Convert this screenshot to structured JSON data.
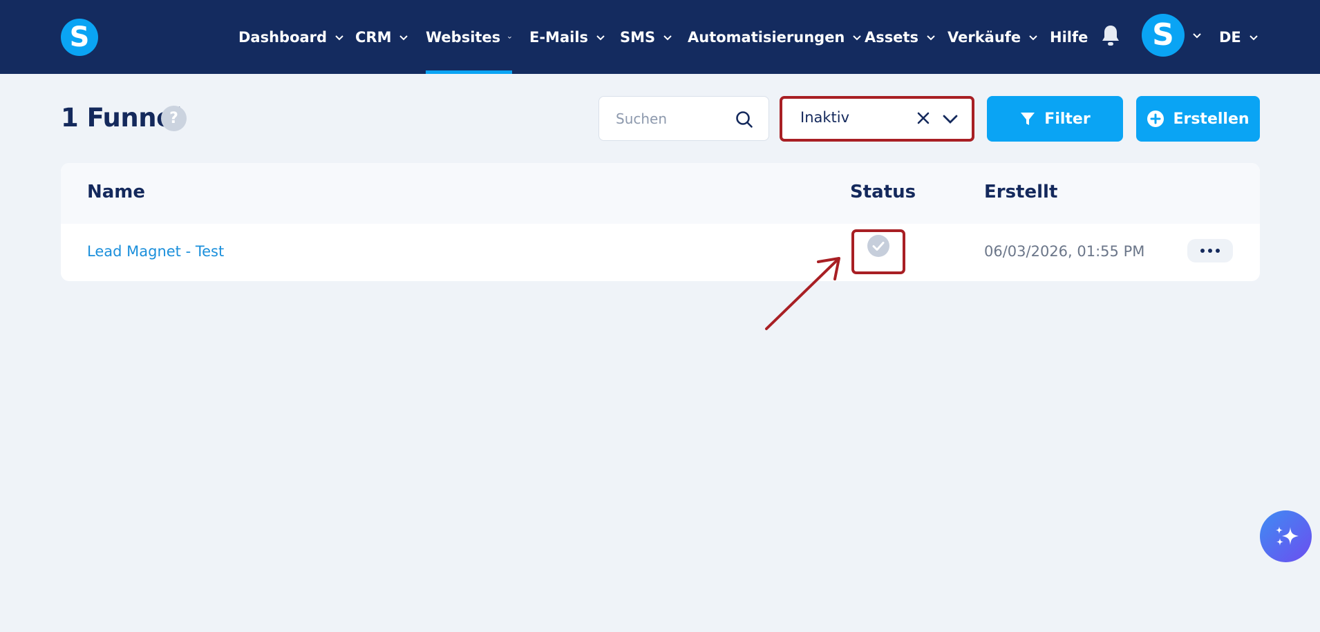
{
  "brand": {
    "logo_letter": "S",
    "accent": "#0aa4f4",
    "nav_bg": "#142b5f"
  },
  "nav": {
    "items": [
      {
        "label": "Dashboard",
        "has_dropdown": true
      },
      {
        "label": "CRM",
        "has_dropdown": true
      },
      {
        "label": "Websites",
        "has_dropdown": true,
        "active": true
      },
      {
        "label": "E-Mails",
        "has_dropdown": true
      },
      {
        "label": "SMS",
        "has_dropdown": true
      },
      {
        "label": "Automatisierungen",
        "has_dropdown": true
      },
      {
        "label": "Assets",
        "has_dropdown": true
      },
      {
        "label": "Verkäufe",
        "has_dropdown": true
      },
      {
        "label": "Hilfe",
        "has_dropdown": false
      }
    ],
    "notifications_icon": "bell-icon",
    "avatar_letter": "S",
    "language": "DE"
  },
  "toolbar": {
    "title": "1 Funnel",
    "help_label": "?",
    "search_placeholder": "Suchen",
    "search_value": "",
    "status_filter_value": "Inaktiv",
    "filter_label": "Filter",
    "create_label": "Erstellen"
  },
  "table": {
    "columns": {
      "name": "Name",
      "status": "Status",
      "created": "Erstellt"
    },
    "rows": [
      {
        "name": "Lead Magnet - Test",
        "status_icon": "check-circle-icon",
        "status_active": false,
        "created": "06/03/2026, 01:55 PM"
      }
    ]
  },
  "annotation_color": "#a81f24",
  "ai_assistant_icon": "sparkles-icon"
}
